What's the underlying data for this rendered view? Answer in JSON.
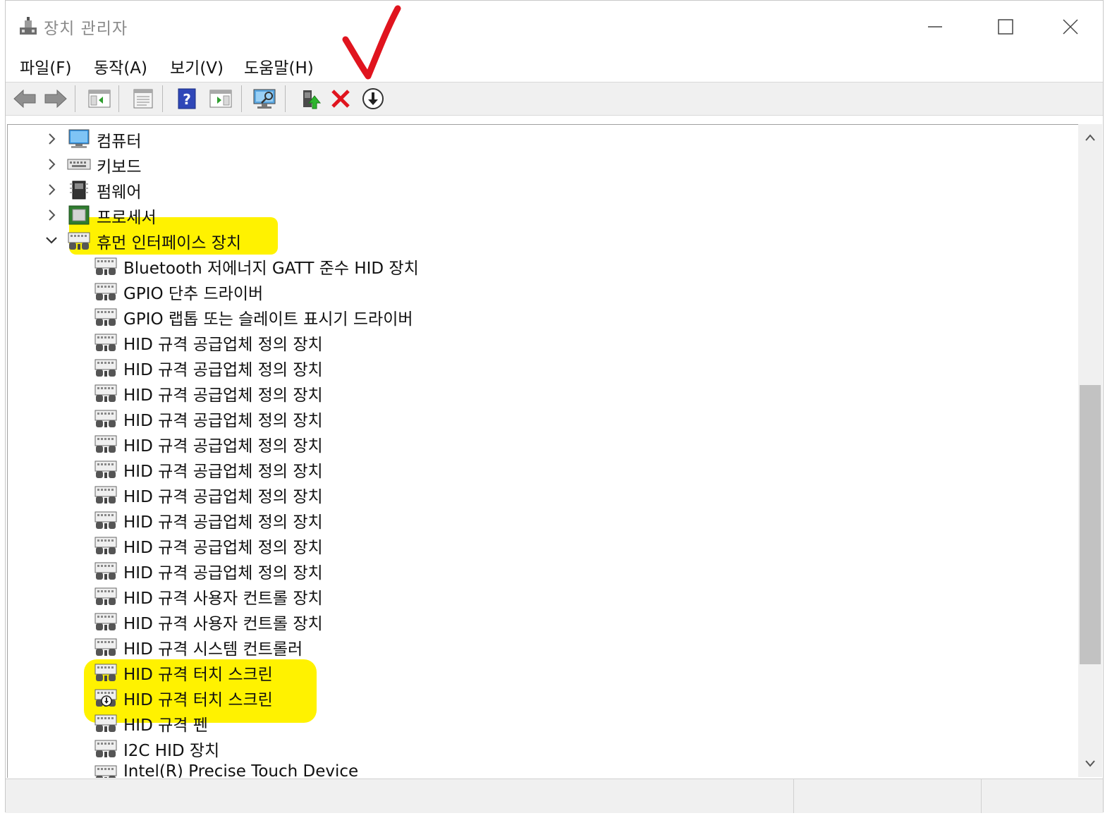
{
  "window": {
    "title": "장치 관리자"
  },
  "menu": [
    "파일(F)",
    "동작(A)",
    "보기(V)",
    "도움말(H)"
  ],
  "toolbar": {
    "buttons": [
      "back",
      "forward",
      "show-hide-console-tree",
      "properties",
      "help",
      "action-pane",
      "scan-hardware",
      "update-driver",
      "uninstall-device",
      "disable-device"
    ],
    "icons": [
      "back-arrow-icon",
      "forward-arrow-icon",
      "console-tree-icon",
      "properties-icon",
      "help-icon",
      "action-pane-icon",
      "monitor-scan-icon",
      "update-driver-icon",
      "uninstall-x-icon",
      "disable-down-icon"
    ]
  },
  "tree": {
    "categories": [
      {
        "label": "컴퓨터",
        "icon": "computer-icon",
        "expanded": false
      },
      {
        "label": "키보드",
        "icon": "keyboard-icon",
        "expanded": false
      },
      {
        "label": "펌웨어",
        "icon": "firmware-chip-icon",
        "expanded": false
      },
      {
        "label": "프로세서",
        "icon": "processor-icon",
        "expanded": false
      },
      {
        "label": "휴먼 인터페이스 장치",
        "icon": "hid-icon",
        "expanded": true,
        "highlighted": true
      }
    ],
    "children": [
      {
        "label": "Bluetooth 저에너지 GATT 준수 HID 장치"
      },
      {
        "label": "GPIO 단추 드라이버"
      },
      {
        "label": "GPIO 랩톱 또는 슬레이트 표시기 드라이버"
      },
      {
        "label": "HID 규격 공급업체 정의 장치"
      },
      {
        "label": "HID 규격 공급업체 정의 장치"
      },
      {
        "label": "HID 규격 공급업체 정의 장치"
      },
      {
        "label": "HID 규격 공급업체 정의 장치"
      },
      {
        "label": "HID 규격 공급업체 정의 장치"
      },
      {
        "label": "HID 규격 공급업체 정의 장치"
      },
      {
        "label": "HID 규격 공급업체 정의 장치"
      },
      {
        "label": "HID 규격 공급업체 정의 장치"
      },
      {
        "label": "HID 규격 공급업체 정의 장치"
      },
      {
        "label": "HID 규격 공급업체 정의 장치"
      },
      {
        "label": "HID 규격 사용자 컨트롤 장치"
      },
      {
        "label": "HID 규격 사용자 컨트롤 장치"
      },
      {
        "label": "HID 규격 시스템 컨트롤러"
      },
      {
        "label": "HID 규격 터치 스크린",
        "highlighted": true
      },
      {
        "label": "HID 규격 터치 스크린",
        "highlighted": true,
        "disabled": true
      },
      {
        "label": "HID 규격 펜"
      },
      {
        "label": "I2C HID 장치"
      },
      {
        "label": "Intel(R) Precise Touch Device"
      }
    ]
  },
  "annotation": {
    "checkmark_color": "#e0141e",
    "highlight_color": "#fff200"
  }
}
